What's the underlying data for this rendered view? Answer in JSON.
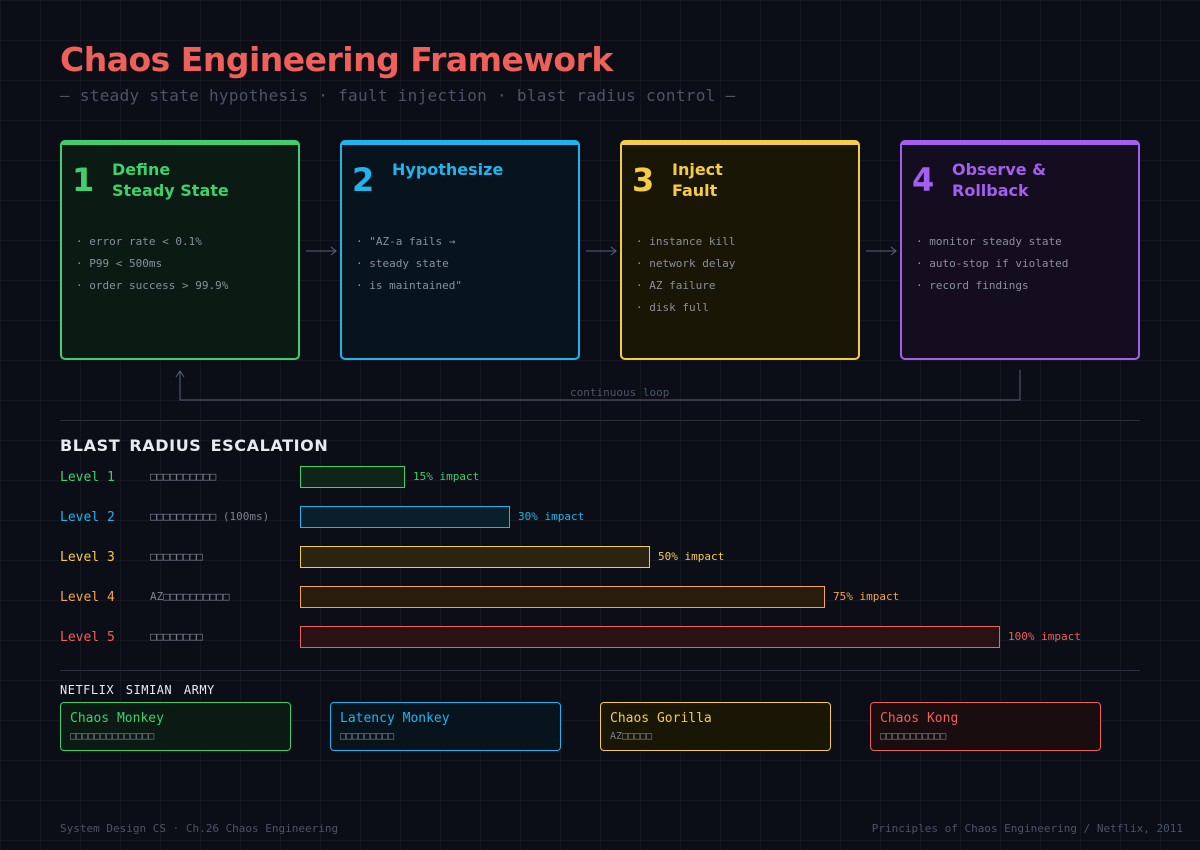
{
  "header": {
    "title": "Chaos Engineering Framework",
    "subtitle": "— steady state hypothesis · fault injection · blast radius control —"
  },
  "steps": [
    {
      "num": "1",
      "title_line1": "Define",
      "title_line2": "Steady State",
      "color": "#3ecf6e",
      "items": [
        "error rate < 0.1%",
        "P99 < 500ms",
        "order success > 99.9%"
      ]
    },
    {
      "num": "2",
      "title_line1": "Hypothesize",
      "title_line2": "",
      "color": "#1fb4ec",
      "items": [
        "\"AZ-a fails →",
        "steady state",
        "is maintained\""
      ]
    },
    {
      "num": "3",
      "title_line1": "Inject",
      "title_line2": "Fault",
      "color": "#f6cc45",
      "items": [
        "instance kill",
        "network delay",
        "AZ failure",
        "disk full"
      ]
    },
    {
      "num": "4",
      "title_line1": "Observe &",
      "title_line2": "Rollback",
      "color": "#a45ef0",
      "items": [
        "monitor steady state",
        "auto-stop if violated",
        "record findings"
      ]
    }
  ],
  "loop_label": "continuous loop",
  "blast": {
    "heading": "BLAST RADIUS ESCALATION",
    "levels": [
      {
        "label": "Level 1",
        "desc": "□□□□□□□□□□",
        "impact_pct": 15,
        "impact_label": "15% impact",
        "color": "#3ecf6e",
        "fill": "#0f2517"
      },
      {
        "label": "Level 2",
        "desc": "□□□□□□□□□□ (100ms)",
        "impact_pct": 30,
        "impact_label": "30% impact",
        "color": "#1fb4ec",
        "fill": "#0a1f2c"
      },
      {
        "label": "Level 3",
        "desc": "□□□□□□□□",
        "impact_pct": 50,
        "impact_label": "50% impact",
        "color": "#f6cc45",
        "fill": "#2a2410"
      },
      {
        "label": "Level 4",
        "desc": "AZ□□□□□□□□□□",
        "impact_pct": 75,
        "impact_label": "75% impact",
        "color": "#f5a54a",
        "fill": "#2a1c0c"
      },
      {
        "label": "Level 5",
        "desc": "□□□□□□□□",
        "impact_pct": 100,
        "impact_label": "100% impact",
        "color": "#f0605a",
        "fill": "#2a1214"
      }
    ]
  },
  "army": {
    "heading": "NETFLIX  SIMIAN  ARMY",
    "cards": [
      {
        "name": "Chaos Monkey",
        "desc": "□□□□□□□□□□□□□□",
        "color": "#3ecf6e",
        "bg": "#0b1a12"
      },
      {
        "name": "Latency Monkey",
        "desc": "□□□□□□□□□",
        "color": "#1fb4ec",
        "bg": "#07141e"
      },
      {
        "name": "Chaos Gorilla",
        "desc": "AZ□□□□□",
        "color": "#f6cc45",
        "bg": "#1a1606"
      },
      {
        "name": "Chaos Kong",
        "desc": "□□□□□□□□□□□",
        "color": "#f0605a",
        "bg": "#1a0d0f"
      }
    ]
  },
  "footer": {
    "left": "System Design CS  ·  Ch.26 Chaos Engineering",
    "right": "Principles of Chaos Engineering  /  Netflix, 2011"
  }
}
